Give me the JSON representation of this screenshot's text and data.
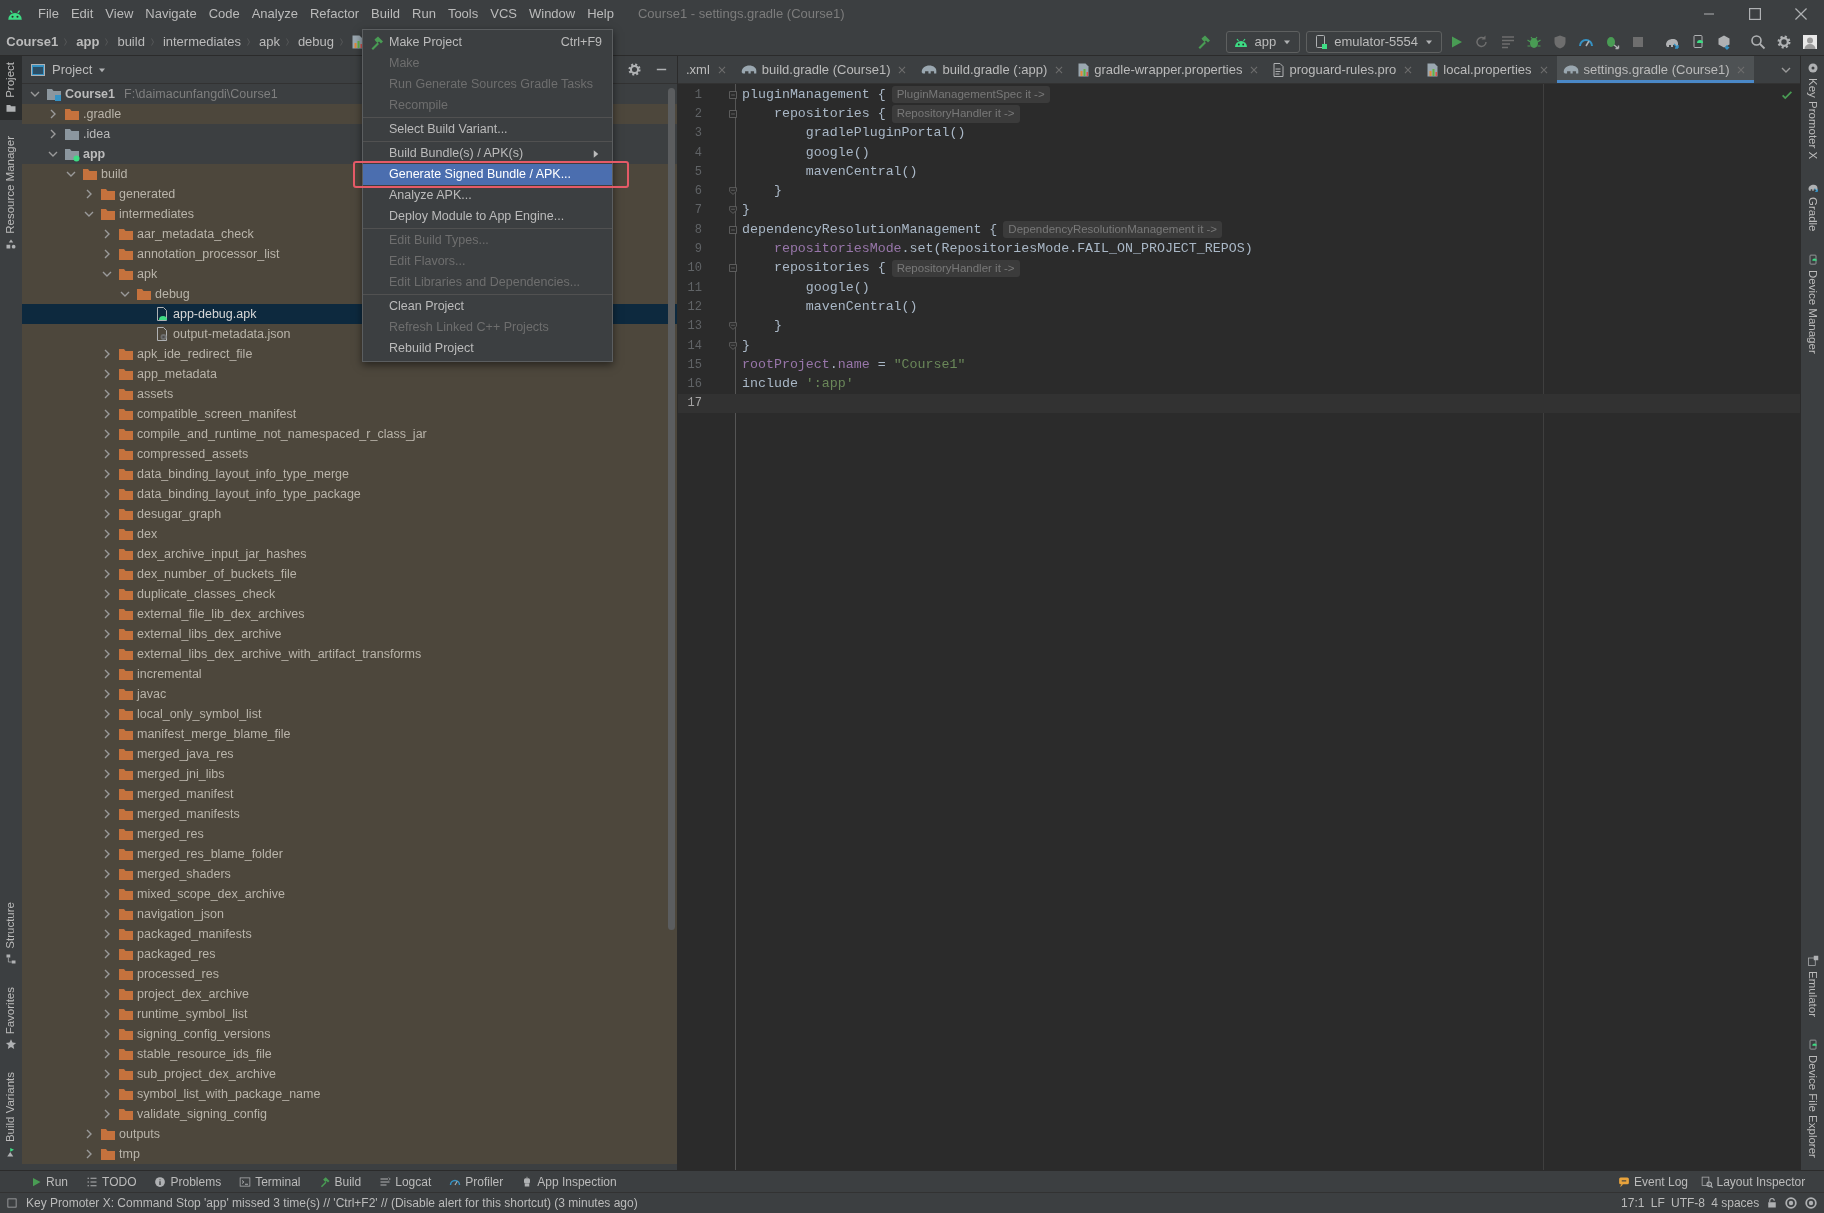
{
  "window": {
    "title": "Course1 - settings.gradle (Course1)",
    "menus": [
      "File",
      "Edit",
      "View",
      "Navigate",
      "Code",
      "Analyze",
      "Refactor",
      "Build",
      "Run",
      "Tools",
      "VCS",
      "Window",
      "Help"
    ]
  },
  "breadcrumb": [
    {
      "label": "Course1",
      "kind": "project"
    },
    {
      "label": "app",
      "kind": "module"
    },
    {
      "label": "build",
      "kind": "folder"
    },
    {
      "label": "intermediates",
      "kind": "folder"
    },
    {
      "label": "apk",
      "kind": "folder"
    },
    {
      "label": "debug",
      "kind": "folder"
    }
  ],
  "toolbar": {
    "run_config": "app",
    "device": "emulator-5554"
  },
  "build_menu": [
    {
      "kind": "action",
      "label": "Make Project",
      "shortcut": "Ctrl+F9",
      "disabled": false,
      "selected": false
    },
    {
      "kind": "action",
      "label": "Make",
      "disabled": true,
      "selected": false
    },
    {
      "kind": "action",
      "label": "Run Generate Sources Gradle Tasks",
      "disabled": true,
      "selected": false
    },
    {
      "kind": "action",
      "label": "Recompile",
      "disabled": true,
      "selected": false
    },
    {
      "kind": "separator"
    },
    {
      "kind": "action",
      "label": "Select Build Variant...",
      "disabled": false,
      "selected": false
    },
    {
      "kind": "separator"
    },
    {
      "kind": "submenu",
      "label": "Build Bundle(s) / APK(s)",
      "disabled": false,
      "selected": false
    },
    {
      "kind": "action",
      "label": "Generate Signed Bundle / APK...",
      "disabled": false,
      "selected": true
    },
    {
      "kind": "action",
      "label": "Analyze APK...",
      "disabled": false,
      "selected": false
    },
    {
      "kind": "action",
      "label": "Deploy Module to App Engine...",
      "disabled": false,
      "selected": false
    },
    {
      "kind": "separator"
    },
    {
      "kind": "action",
      "label": "Edit Build Types...",
      "disabled": true,
      "selected": false
    },
    {
      "kind": "action",
      "label": "Edit Flavors...",
      "disabled": true,
      "selected": false
    },
    {
      "kind": "action",
      "label": "Edit Libraries and Dependencies...",
      "disabled": true,
      "selected": false
    },
    {
      "kind": "separator"
    },
    {
      "kind": "action",
      "label": "Clean Project",
      "disabled": false,
      "selected": false
    },
    {
      "kind": "action",
      "label": "Refresh Linked C++ Projects",
      "disabled": true,
      "selected": false
    },
    {
      "kind": "action",
      "label": "Rebuild Project",
      "disabled": false,
      "selected": false
    }
  ],
  "left_tool_strip": {
    "top": [
      {
        "label": "Project",
        "selected": true
      },
      {
        "label": "Resource Manager",
        "selected": false
      }
    ],
    "bottom": [
      {
        "label": "Structure",
        "selected": false
      },
      {
        "label": "Favorites",
        "selected": false
      },
      {
        "label": "Build Variants",
        "selected": false
      }
    ]
  },
  "right_tool_strip": {
    "top": [
      {
        "label": "Key Promoter X",
        "selected": false
      },
      {
        "label": "Gradle",
        "selected": false
      },
      {
        "label": "Device Manager",
        "selected": false
      }
    ],
    "bottom": [
      {
        "label": "Emulator",
        "selected": false
      },
      {
        "label": "Device File Explorer",
        "selected": false
      }
    ]
  },
  "project_panel": {
    "title": "Project",
    "tree": [
      {
        "label": "Course1",
        "path": "F:\\daimacunfangdi\\Course1",
        "kind": "project",
        "expanded": true,
        "excluded": false,
        "selected": false,
        "children": [
          {
            "label": ".gradle",
            "kind": "folder",
            "expanded": false,
            "excluded": true,
            "selected": false
          },
          {
            "label": ".idea",
            "kind": "folder",
            "expanded": false,
            "excluded": false,
            "selected": false
          },
          {
            "label": "app",
            "kind": "module",
            "expanded": true,
            "excluded": false,
            "selected": false,
            "children": [
              {
                "label": "build",
                "kind": "folder",
                "expanded": true,
                "excluded": true,
                "selected": false,
                "children": [
                  {
                    "label": "generated",
                    "kind": "folder",
                    "expanded": false,
                    "excluded": true,
                    "selected": false
                  },
                  {
                    "label": "intermediates",
                    "kind": "folder",
                    "expanded": true,
                    "excluded": true,
                    "selected": false,
                    "children": [
                      {
                        "label": "aar_metadata_check",
                        "kind": "folder",
                        "expanded": false,
                        "excluded": true,
                        "selected": false
                      },
                      {
                        "label": "annotation_processor_list",
                        "kind": "folder",
                        "expanded": false,
                        "excluded": true,
                        "selected": false
                      },
                      {
                        "label": "apk",
                        "kind": "folder",
                        "expanded": true,
                        "excluded": true,
                        "selected": false,
                        "children": [
                          {
                            "label": "debug",
                            "kind": "folder",
                            "expanded": true,
                            "excluded": true,
                            "selected": false,
                            "children": [
                              {
                                "label": "app-debug.apk",
                                "kind": "apk",
                                "selected": true
                              },
                              {
                                "label": "output-metadata.json",
                                "kind": "json",
                                "excluded": true,
                                "selected": false
                              }
                            ]
                          }
                        ]
                      },
                      {
                        "label": "apk_ide_redirect_file",
                        "kind": "folder",
                        "expanded": false,
                        "excluded": true,
                        "selected": false
                      },
                      {
                        "label": "app_metadata",
                        "kind": "folder",
                        "expanded": false,
                        "excluded": true,
                        "selected": false
                      },
                      {
                        "label": "assets",
                        "kind": "folder",
                        "expanded": false,
                        "excluded": true,
                        "selected": false
                      },
                      {
                        "label": "compatible_screen_manifest",
                        "kind": "folder",
                        "expanded": false,
                        "excluded": true,
                        "selected": false
                      },
                      {
                        "label": "compile_and_runtime_not_namespaced_r_class_jar",
                        "kind": "folder",
                        "expanded": false,
                        "excluded": true,
                        "selected": false
                      },
                      {
                        "label": "compressed_assets",
                        "kind": "folder",
                        "expanded": false,
                        "excluded": true,
                        "selected": false
                      },
                      {
                        "label": "data_binding_layout_info_type_merge",
                        "kind": "folder",
                        "expanded": false,
                        "excluded": true,
                        "selected": false
                      },
                      {
                        "label": "data_binding_layout_info_type_package",
                        "kind": "folder",
                        "expanded": false,
                        "excluded": true,
                        "selected": false
                      },
                      {
                        "label": "desugar_graph",
                        "kind": "folder",
                        "expanded": false,
                        "excluded": true,
                        "selected": false
                      },
                      {
                        "label": "dex",
                        "kind": "folder",
                        "expanded": false,
                        "excluded": true,
                        "selected": false
                      },
                      {
                        "label": "dex_archive_input_jar_hashes",
                        "kind": "folder",
                        "expanded": false,
                        "excluded": true,
                        "selected": false
                      },
                      {
                        "label": "dex_number_of_buckets_file",
                        "kind": "folder",
                        "expanded": false,
                        "excluded": true,
                        "selected": false
                      },
                      {
                        "label": "duplicate_classes_check",
                        "kind": "folder",
                        "expanded": false,
                        "excluded": true,
                        "selected": false
                      },
                      {
                        "label": "external_file_lib_dex_archives",
                        "kind": "folder",
                        "expanded": false,
                        "excluded": true,
                        "selected": false
                      },
                      {
                        "label": "external_libs_dex_archive",
                        "kind": "folder",
                        "expanded": false,
                        "excluded": true,
                        "selected": false
                      },
                      {
                        "label": "external_libs_dex_archive_with_artifact_transforms",
                        "kind": "folder",
                        "expanded": false,
                        "excluded": true,
                        "selected": false
                      },
                      {
                        "label": "incremental",
                        "kind": "folder",
                        "expanded": false,
                        "excluded": true,
                        "selected": false
                      },
                      {
                        "label": "javac",
                        "kind": "folder",
                        "expanded": false,
                        "excluded": true,
                        "selected": false
                      },
                      {
                        "label": "local_only_symbol_list",
                        "kind": "folder",
                        "expanded": false,
                        "excluded": true,
                        "selected": false
                      },
                      {
                        "label": "manifest_merge_blame_file",
                        "kind": "folder",
                        "expanded": false,
                        "excluded": true,
                        "selected": false
                      },
                      {
                        "label": "merged_java_res",
                        "kind": "folder",
                        "expanded": false,
                        "excluded": true,
                        "selected": false
                      },
                      {
                        "label": "merged_jni_libs",
                        "kind": "folder",
                        "expanded": false,
                        "excluded": true,
                        "selected": false
                      },
                      {
                        "label": "merged_manifest",
                        "kind": "folder",
                        "expanded": false,
                        "excluded": true,
                        "selected": false
                      },
                      {
                        "label": "merged_manifests",
                        "kind": "folder",
                        "expanded": false,
                        "excluded": true,
                        "selected": false
                      },
                      {
                        "label": "merged_res",
                        "kind": "folder",
                        "expanded": false,
                        "excluded": true,
                        "selected": false
                      },
                      {
                        "label": "merged_res_blame_folder",
                        "kind": "folder",
                        "expanded": false,
                        "excluded": true,
                        "selected": false
                      },
                      {
                        "label": "merged_shaders",
                        "kind": "folder",
                        "expanded": false,
                        "excluded": true,
                        "selected": false
                      },
                      {
                        "label": "mixed_scope_dex_archive",
                        "kind": "folder",
                        "expanded": false,
                        "excluded": true,
                        "selected": false
                      },
                      {
                        "label": "navigation_json",
                        "kind": "folder",
                        "expanded": false,
                        "excluded": true,
                        "selected": false
                      },
                      {
                        "label": "packaged_manifests",
                        "kind": "folder",
                        "expanded": false,
                        "excluded": true,
                        "selected": false
                      },
                      {
                        "label": "packaged_res",
                        "kind": "folder",
                        "expanded": false,
                        "excluded": true,
                        "selected": false
                      },
                      {
                        "label": "processed_res",
                        "kind": "folder",
                        "expanded": false,
                        "excluded": true,
                        "selected": false
                      },
                      {
                        "label": "project_dex_archive",
                        "kind": "folder",
                        "expanded": false,
                        "excluded": true,
                        "selected": false
                      },
                      {
                        "label": "runtime_symbol_list",
                        "kind": "folder",
                        "expanded": false,
                        "excluded": true,
                        "selected": false
                      },
                      {
                        "label": "signing_config_versions",
                        "kind": "folder",
                        "expanded": false,
                        "excluded": true,
                        "selected": false
                      },
                      {
                        "label": "stable_resource_ids_file",
                        "kind": "folder",
                        "expanded": false,
                        "excluded": true,
                        "selected": false
                      },
                      {
                        "label": "sub_project_dex_archive",
                        "kind": "folder",
                        "expanded": false,
                        "excluded": true,
                        "selected": false
                      },
                      {
                        "label": "symbol_list_with_package_name",
                        "kind": "folder",
                        "expanded": false,
                        "excluded": true,
                        "selected": false
                      },
                      {
                        "label": "validate_signing_config",
                        "kind": "folder",
                        "expanded": false,
                        "excluded": true,
                        "selected": false
                      }
                    ]
                  },
                  {
                    "label": "outputs",
                    "kind": "folder",
                    "expanded": false,
                    "excluded": true,
                    "selected": false
                  },
                  {
                    "label": "tmp",
                    "kind": "folder",
                    "expanded": false,
                    "excluded": true,
                    "selected": false
                  }
                ]
              }
            ]
          }
        ]
      }
    ]
  },
  "editor": {
    "tabs": [
      {
        "label": ".xml",
        "kind": "xml",
        "selected": false
      },
      {
        "label": "build.gradle (Course1)",
        "kind": "gradle",
        "selected": false
      },
      {
        "label": "build.gradle (:app)",
        "kind": "gradle",
        "selected": false
      },
      {
        "label": "gradle-wrapper.properties",
        "kind": "properties",
        "selected": false
      },
      {
        "label": "proguard-rules.pro",
        "kind": "text",
        "selected": false
      },
      {
        "label": "local.properties",
        "kind": "properties",
        "selected": false
      },
      {
        "label": "settings.gradle (Course1)",
        "kind": "gradle",
        "selected": true
      }
    ],
    "lines": [
      {
        "number": "1",
        "fold_start": true,
        "current": false,
        "segments": [
          {
            "kind": "code",
            "text": "pluginManagement {"
          },
          {
            "kind": "hint",
            "text": "PluginManagementSpec it ->"
          }
        ]
      },
      {
        "number": "2",
        "fold_start": true,
        "current": false,
        "segments": [
          {
            "kind": "code",
            "text": "    repositories {"
          },
          {
            "kind": "hint",
            "text": "RepositoryHandler it ->"
          }
        ]
      },
      {
        "number": "3",
        "current": false,
        "segments": [
          {
            "kind": "code",
            "text": "        gradlePluginPortal()"
          }
        ]
      },
      {
        "number": "4",
        "current": false,
        "segments": [
          {
            "kind": "code",
            "text": "        google()"
          }
        ]
      },
      {
        "number": "5",
        "current": false,
        "segments": [
          {
            "kind": "code",
            "text": "        mavenCentral()"
          }
        ]
      },
      {
        "number": "6",
        "fold_end": true,
        "current": false,
        "segments": [
          {
            "kind": "code",
            "text": "    }"
          }
        ]
      },
      {
        "number": "7",
        "fold_end": true,
        "current": false,
        "segments": [
          {
            "kind": "code",
            "text": "}"
          }
        ]
      },
      {
        "number": "8",
        "fold_start": true,
        "current": false,
        "segments": [
          {
            "kind": "code",
            "text": "dependencyResolutionManagement {"
          },
          {
            "kind": "hint",
            "text": "DependencyResolutionManagement it ->"
          }
        ]
      },
      {
        "number": "9",
        "current": false,
        "segments": [
          {
            "kind": "field",
            "text": "    repositoriesMode"
          },
          {
            "kind": "code",
            "text": ".set(RepositoriesMode.FAIL_ON_PROJECT_REPOS)"
          }
        ]
      },
      {
        "number": "10",
        "fold_start": true,
        "current": false,
        "segments": [
          {
            "kind": "code",
            "text": "    repositories {"
          },
          {
            "kind": "hint",
            "text": "RepositoryHandler it ->"
          }
        ]
      },
      {
        "number": "11",
        "current": false,
        "segments": [
          {
            "kind": "code",
            "text": "        google()"
          }
        ]
      },
      {
        "number": "12",
        "current": false,
        "segments": [
          {
            "kind": "code",
            "text": "        mavenCentral()"
          }
        ]
      },
      {
        "number": "13",
        "fold_end": true,
        "current": false,
        "segments": [
          {
            "kind": "code",
            "text": "    }"
          }
        ]
      },
      {
        "number": "14",
        "fold_end": true,
        "current": false,
        "segments": [
          {
            "kind": "code",
            "text": "}"
          }
        ]
      },
      {
        "number": "15",
        "current": false,
        "segments": [
          {
            "kind": "field",
            "text": "rootProject"
          },
          {
            "kind": "code",
            "text": "."
          },
          {
            "kind": "field",
            "text": "name"
          },
          {
            "kind": "code",
            "text": " = "
          },
          {
            "kind": "string",
            "text": "\"Course1\""
          }
        ]
      },
      {
        "number": "16",
        "current": false,
        "segments": [
          {
            "kind": "code",
            "text": "include "
          },
          {
            "kind": "string",
            "text": "':app'"
          }
        ]
      },
      {
        "number": "17",
        "current": true
      }
    ]
  },
  "tool_windows": {
    "left": [
      {
        "label": "Run",
        "kind": "run"
      },
      {
        "label": "TODO",
        "kind": "todo"
      },
      {
        "label": "Problems",
        "kind": "problems"
      },
      {
        "label": "Terminal",
        "kind": "terminal"
      },
      {
        "label": "Build",
        "kind": "build"
      },
      {
        "label": "Logcat",
        "kind": "logcat"
      },
      {
        "label": "Profiler",
        "kind": "profiler"
      },
      {
        "label": "App Inspection",
        "kind": "inspection"
      }
    ],
    "right": [
      {
        "label": "Event Log",
        "kind": "eventlog"
      },
      {
        "label": "Layout Inspector",
        "kind": "layout"
      }
    ]
  },
  "status_bar": {
    "message": "Key Promoter X: Command Stop 'app' missed 3 time(s) // 'Ctrl+F2' // (Disable alert for this shortcut) (3 minutes ago)",
    "items": [
      "17:1",
      "LF",
      "UTF-8",
      "4 spaces"
    ]
  }
}
